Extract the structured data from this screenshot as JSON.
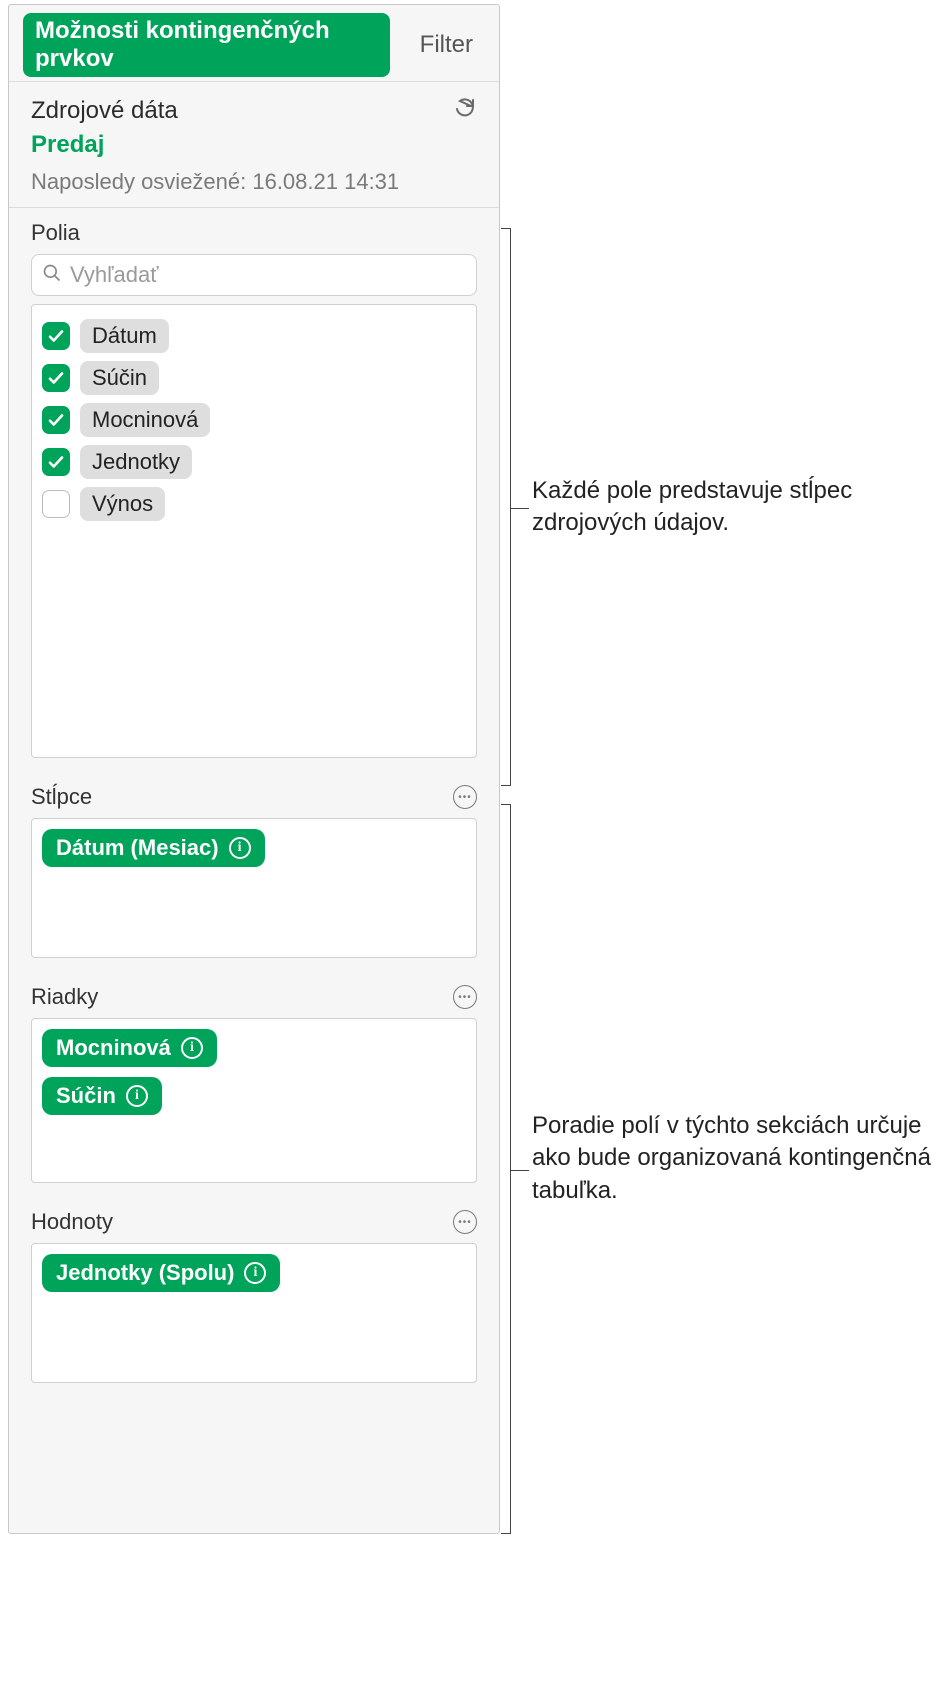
{
  "tabs": {
    "pivot_options": "Možnosti kontingenčných prvkov",
    "filter": "Filter"
  },
  "source": {
    "title": "Zdrojové dáta",
    "name": "Predaj",
    "last_refresh": "Naposledy osviežené: 16.08.21  14:31"
  },
  "fields": {
    "label": "Polia",
    "search_placeholder": "Vyhľadať",
    "items": [
      {
        "label": "Dátum",
        "checked": true
      },
      {
        "label": "Súčin",
        "checked": true
      },
      {
        "label": "Mocninová",
        "checked": true
      },
      {
        "label": "Jednotky",
        "checked": true
      },
      {
        "label": "Výnos",
        "checked": false
      }
    ]
  },
  "columns": {
    "label": "Stĺpce",
    "items": [
      {
        "label": "Dátum (Mesiac)"
      }
    ]
  },
  "rows": {
    "label": "Riadky",
    "items": [
      {
        "label": "Mocninová"
      },
      {
        "label": "Súčin"
      }
    ]
  },
  "values": {
    "label": "Hodnoty",
    "items": [
      {
        "label": "Jednotky (Spolu)"
      }
    ]
  },
  "callouts": {
    "fields": "Každé pole predstavuje stĺpec zdrojových údajov.",
    "zones": "Poradie polí v týchto sekciách určuje ako bude organizovaná kontingenčná tabuľka."
  }
}
